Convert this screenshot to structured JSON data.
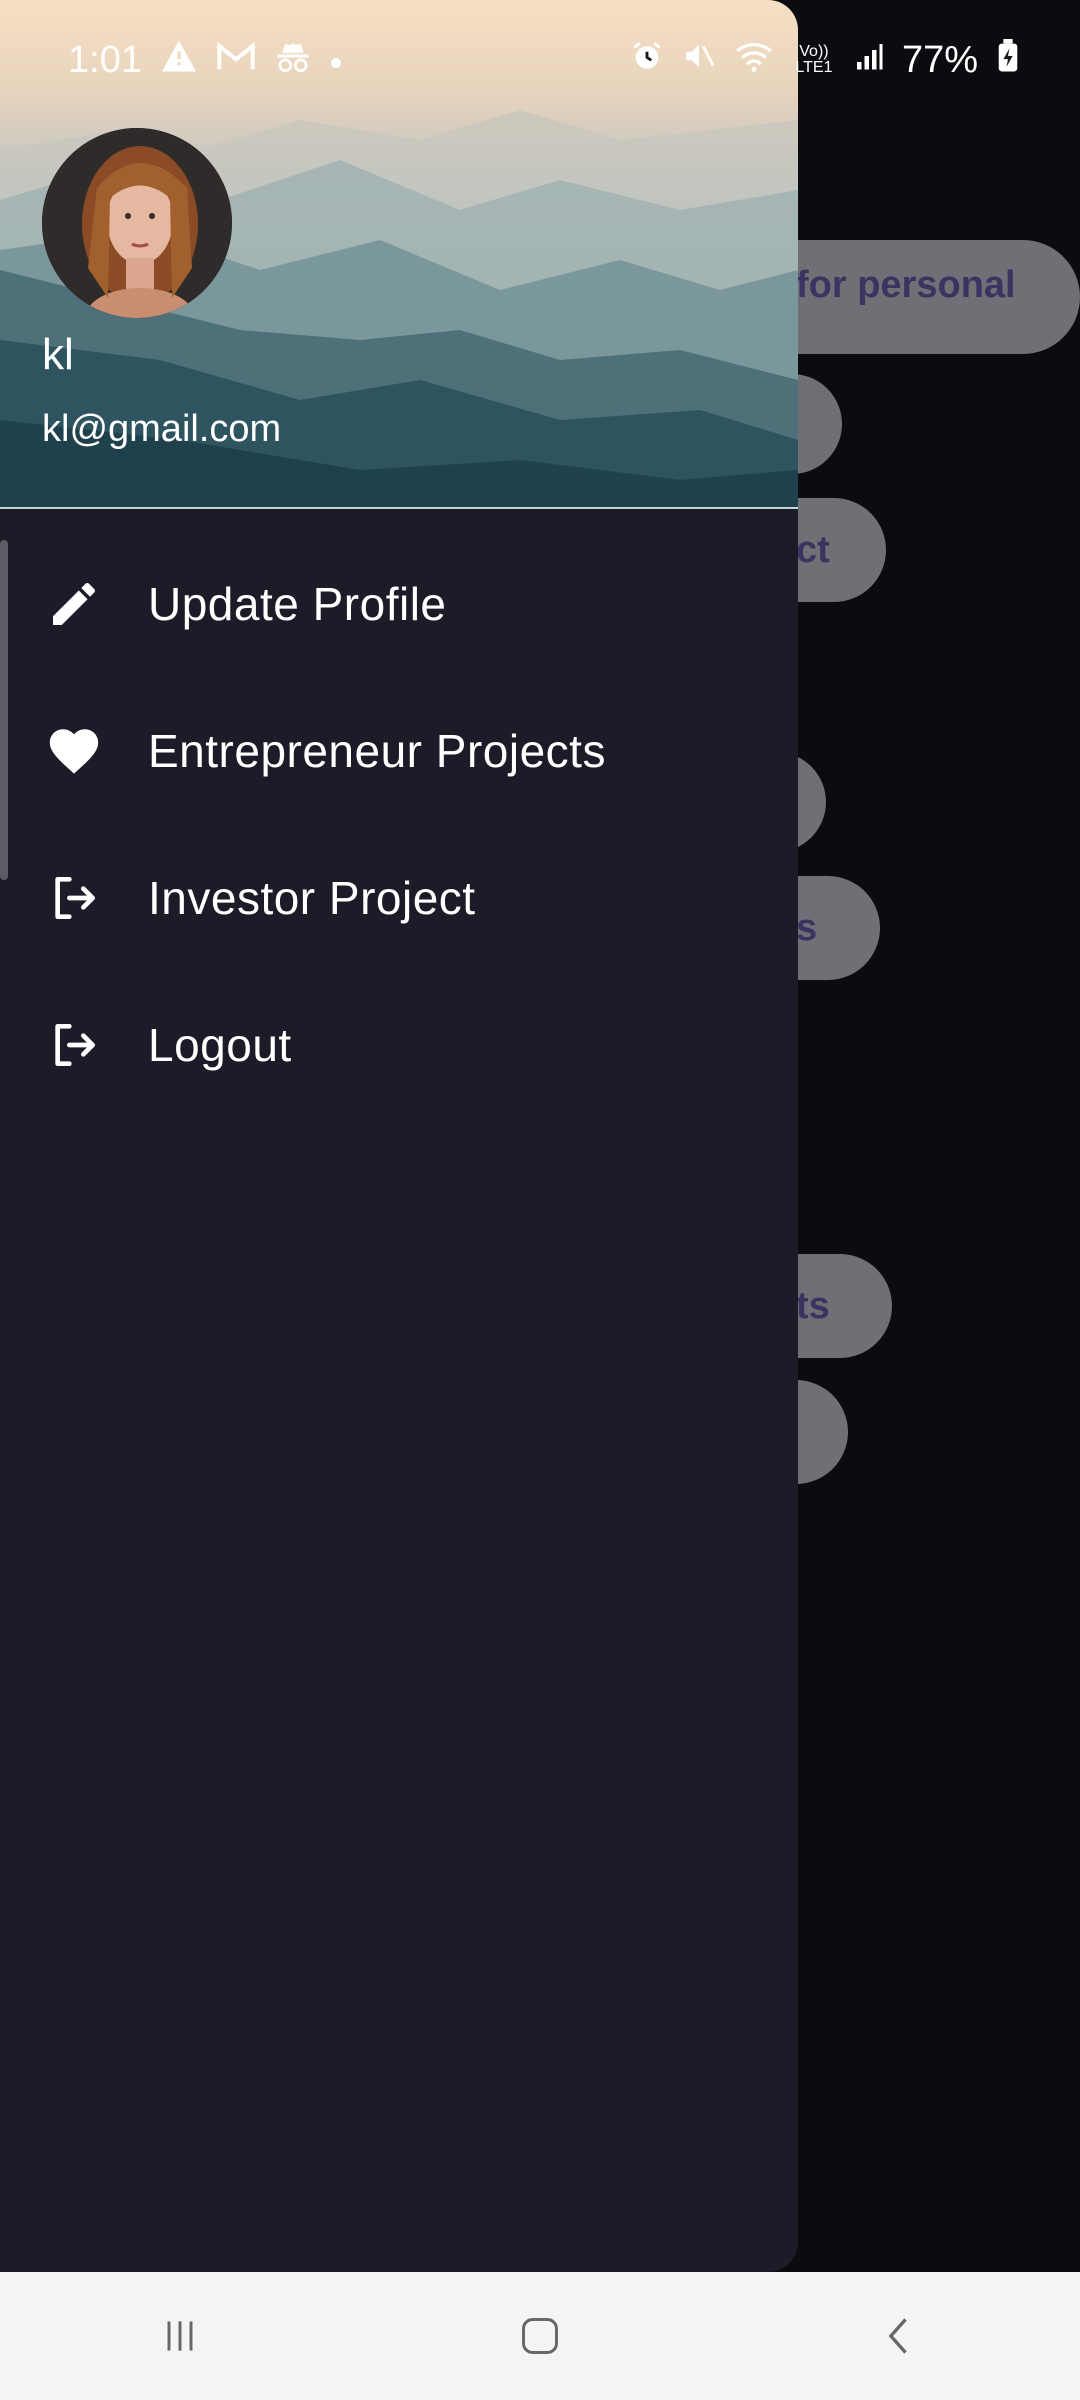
{
  "status_bar": {
    "time": "1:01",
    "battery": "77%",
    "left_icons": [
      "warning-icon",
      "gmail-icon",
      "incognito-icon",
      "dot-icon"
    ],
    "right_icons": [
      "alarm-icon",
      "mute-icon",
      "wifi-icon",
      "volte-lte-icon",
      "signal-icon",
      "battery-charging-icon"
    ],
    "volte_label": "Vo)) LTE1"
  },
  "drawer": {
    "user_name": "kl",
    "user_email": "kl@gmail.com",
    "menu": [
      {
        "label": "Update Profile",
        "icon": "pencil-icon"
      },
      {
        "label": "Entrepreneur Projects",
        "icon": "heart-icon"
      },
      {
        "label": "Investor Project",
        "icon": "logout-icon"
      },
      {
        "label": "Logout",
        "icon": "logout-icon"
      }
    ]
  },
  "background": {
    "pill_texts": [
      "for personal",
      "",
      "ct",
      "",
      "s",
      "ts",
      ""
    ]
  },
  "nav_bar": {
    "buttons": [
      "recent-apps-icon",
      "home-icon",
      "back-icon"
    ]
  },
  "colors": {
    "drawer_bg": "#1c1b27",
    "pill_bg": "#6f6f75",
    "pill_text": "#3a3560",
    "nav_bg": "#f4f4f4"
  }
}
